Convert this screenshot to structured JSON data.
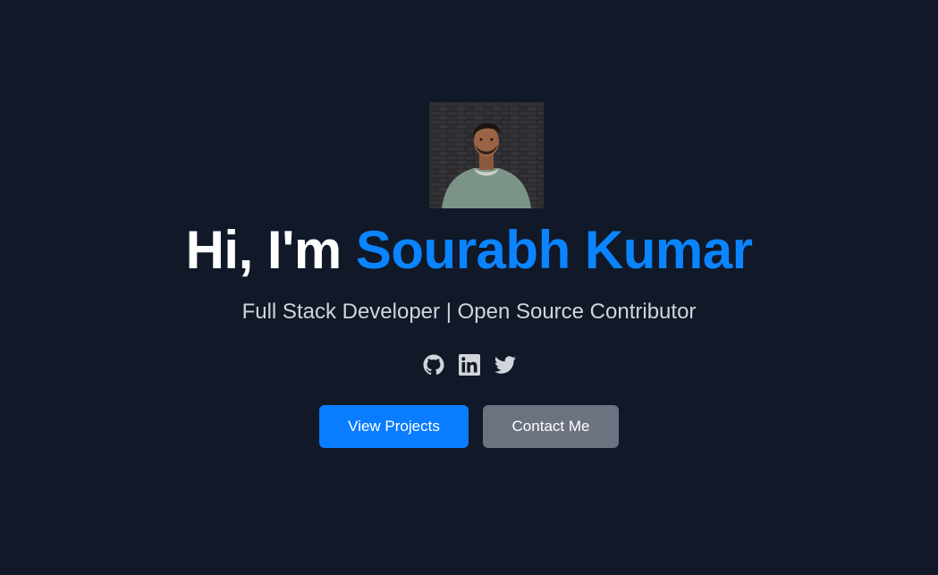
{
  "hero": {
    "avatar_alt": "Sourabh Kumar profile photo",
    "greeting": "Hi, I'm",
    "name": "Sourabh Kumar",
    "tagline": "Full Stack Developer | Open Source Contributor"
  },
  "socials": [
    {
      "icon": "github-icon",
      "label": "GitHub"
    },
    {
      "icon": "linkedin-icon",
      "label": "LinkedIn"
    },
    {
      "icon": "twitter-icon",
      "label": "Twitter"
    }
  ],
  "actions": {
    "primary_label": "View Projects",
    "secondary_label": "Contact Me"
  },
  "colors": {
    "background": "#111827",
    "accent": "#0a84ff",
    "primary_button": "#0a7cff",
    "secondary_button": "#6b7280",
    "muted_text": "#d1d5db"
  }
}
